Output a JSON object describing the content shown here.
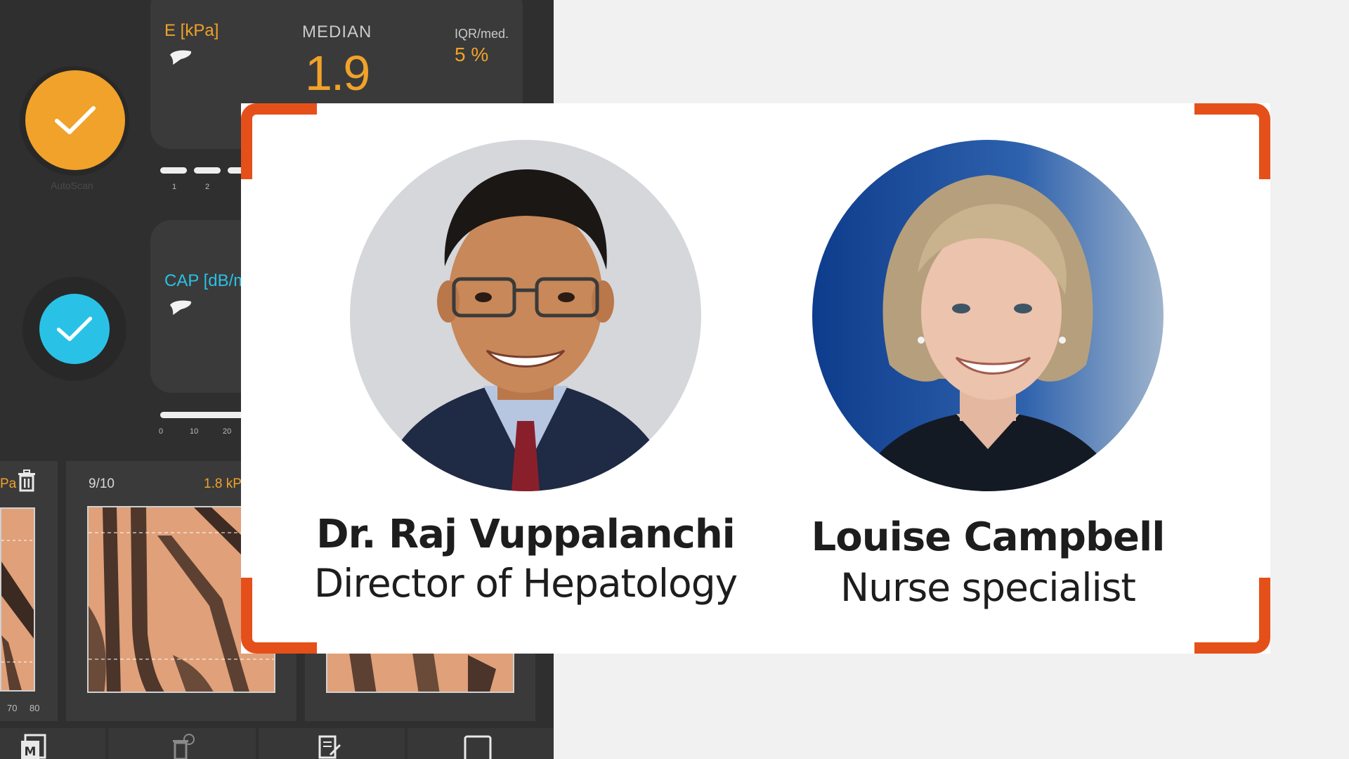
{
  "device": {
    "elasticity": {
      "label": "E [kPa]",
      "median_label": "MEDIAN",
      "median_value": "1.9",
      "iqr_label": "IQR/med.",
      "iqr_value": "5 %",
      "autoscan_label": "AutoScan",
      "progress_ticks": [
        "1",
        "2"
      ]
    },
    "cap": {
      "label": "CAP [dB/m",
      "axis_ticks": [
        "0",
        "10",
        "20"
      ]
    },
    "thumbnails": {
      "left_value": "Pa",
      "count": "9/10",
      "value": "1.8 kP",
      "left_axis_ticks": [
        "70",
        "80"
      ]
    },
    "colors": {
      "orange": "#f0a22a",
      "blue": "#29c2e6"
    }
  },
  "people": [
    {
      "name": "Dr. Raj Vuppalanchi",
      "role": "Director of Hepatology"
    },
    {
      "name": "Louise Campbell",
      "role": "Nurse specialist"
    }
  ],
  "accent": "#e5501a"
}
